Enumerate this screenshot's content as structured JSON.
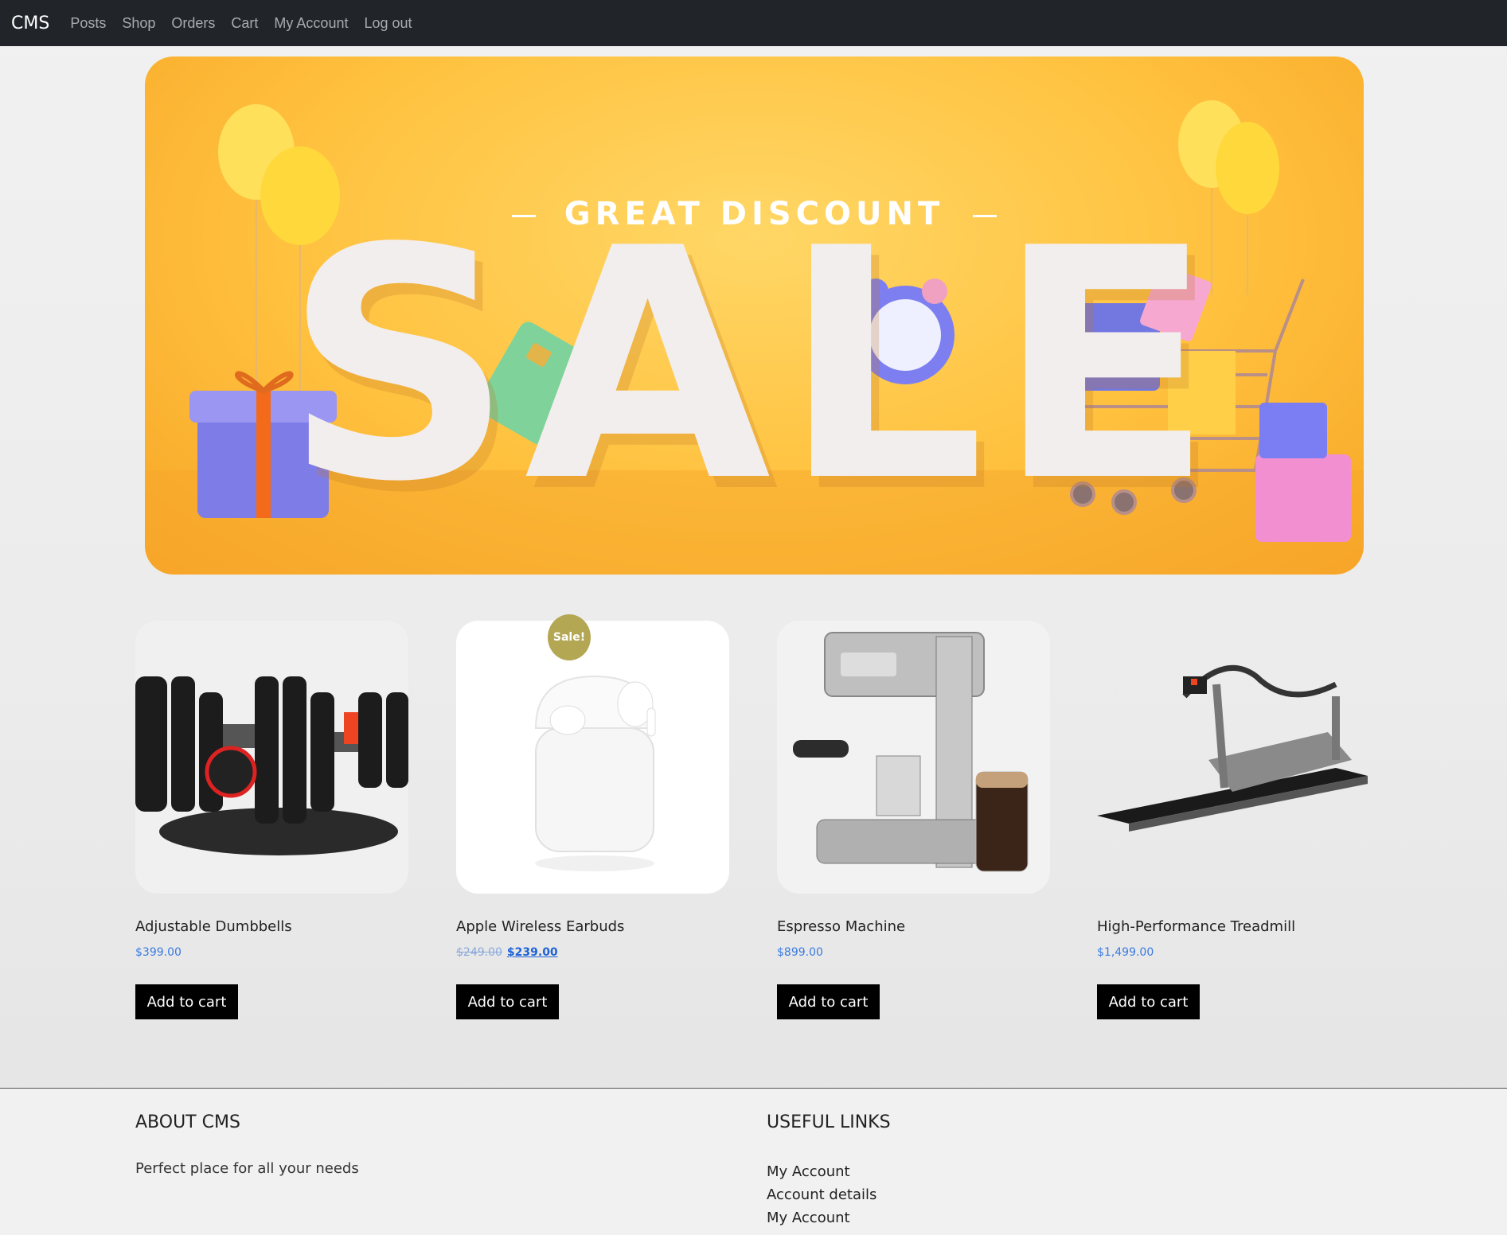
{
  "navbar": {
    "brand": "CMS",
    "links": [
      "Posts",
      "Shop",
      "Orders",
      "Cart",
      "My Account",
      "Log out"
    ]
  },
  "hero": {
    "subtitle": "GREAT DISCOUNT",
    "title": "SALE"
  },
  "products": [
    {
      "name": "Adjustable Dumbbells",
      "price": "$399.00"
    },
    {
      "name": "Apple Wireless Earbuds",
      "old_price": "$249.00",
      "price": "$239.00",
      "badge": "Sale!"
    },
    {
      "name": "Espresso Machine",
      "price": "$899.00"
    },
    {
      "name": "High-Performance Treadmill",
      "price": "$1,499.00"
    }
  ],
  "add_to_cart_label": "Add to cart",
  "footer": {
    "about_title": "ABOUT CMS",
    "about_text": "Perfect place for all your needs",
    "links_title": "USEFUL LINKS",
    "links": [
      "My Account",
      "Account details",
      "My Account"
    ]
  },
  "colors": {
    "navbar_bg": "#212529",
    "hero_bg": "#ffc13e",
    "price": "#3a7be0",
    "sale_badge": "#b3a754",
    "button_bg": "#000000"
  }
}
